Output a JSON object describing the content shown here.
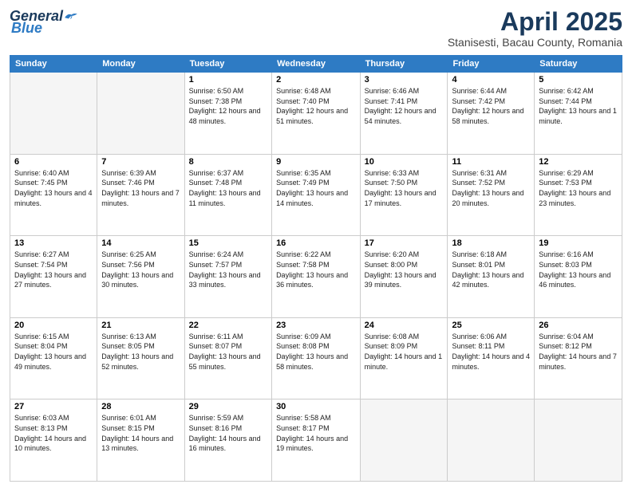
{
  "header": {
    "logo": {
      "general": "General",
      "blue": "Blue"
    },
    "month": "April 2025",
    "location": "Stanisesti, Bacau County, Romania"
  },
  "weekdays": [
    "Sunday",
    "Monday",
    "Tuesday",
    "Wednesday",
    "Thursday",
    "Friday",
    "Saturday"
  ],
  "weeks": [
    [
      {
        "num": "",
        "empty": true
      },
      {
        "num": "",
        "empty": true
      },
      {
        "num": "1",
        "sunrise": "6:50 AM",
        "sunset": "7:38 PM",
        "daylight": "12 hours and 48 minutes."
      },
      {
        "num": "2",
        "sunrise": "6:48 AM",
        "sunset": "7:40 PM",
        "daylight": "12 hours and 51 minutes."
      },
      {
        "num": "3",
        "sunrise": "6:46 AM",
        "sunset": "7:41 PM",
        "daylight": "12 hours and 54 minutes."
      },
      {
        "num": "4",
        "sunrise": "6:44 AM",
        "sunset": "7:42 PM",
        "daylight": "12 hours and 58 minutes."
      },
      {
        "num": "5",
        "sunrise": "6:42 AM",
        "sunset": "7:44 PM",
        "daylight": "13 hours and 1 minute."
      }
    ],
    [
      {
        "num": "6",
        "sunrise": "6:40 AM",
        "sunset": "7:45 PM",
        "daylight": "13 hours and 4 minutes."
      },
      {
        "num": "7",
        "sunrise": "6:39 AM",
        "sunset": "7:46 PM",
        "daylight": "13 hours and 7 minutes."
      },
      {
        "num": "8",
        "sunrise": "6:37 AM",
        "sunset": "7:48 PM",
        "daylight": "13 hours and 11 minutes."
      },
      {
        "num": "9",
        "sunrise": "6:35 AM",
        "sunset": "7:49 PM",
        "daylight": "13 hours and 14 minutes."
      },
      {
        "num": "10",
        "sunrise": "6:33 AM",
        "sunset": "7:50 PM",
        "daylight": "13 hours and 17 minutes."
      },
      {
        "num": "11",
        "sunrise": "6:31 AM",
        "sunset": "7:52 PM",
        "daylight": "13 hours and 20 minutes."
      },
      {
        "num": "12",
        "sunrise": "6:29 AM",
        "sunset": "7:53 PM",
        "daylight": "13 hours and 23 minutes."
      }
    ],
    [
      {
        "num": "13",
        "sunrise": "6:27 AM",
        "sunset": "7:54 PM",
        "daylight": "13 hours and 27 minutes."
      },
      {
        "num": "14",
        "sunrise": "6:25 AM",
        "sunset": "7:56 PM",
        "daylight": "13 hours and 30 minutes."
      },
      {
        "num": "15",
        "sunrise": "6:24 AM",
        "sunset": "7:57 PM",
        "daylight": "13 hours and 33 minutes."
      },
      {
        "num": "16",
        "sunrise": "6:22 AM",
        "sunset": "7:58 PM",
        "daylight": "13 hours and 36 minutes."
      },
      {
        "num": "17",
        "sunrise": "6:20 AM",
        "sunset": "8:00 PM",
        "daylight": "13 hours and 39 minutes."
      },
      {
        "num": "18",
        "sunrise": "6:18 AM",
        "sunset": "8:01 PM",
        "daylight": "13 hours and 42 minutes."
      },
      {
        "num": "19",
        "sunrise": "6:16 AM",
        "sunset": "8:03 PM",
        "daylight": "13 hours and 46 minutes."
      }
    ],
    [
      {
        "num": "20",
        "sunrise": "6:15 AM",
        "sunset": "8:04 PM",
        "daylight": "13 hours and 49 minutes."
      },
      {
        "num": "21",
        "sunrise": "6:13 AM",
        "sunset": "8:05 PM",
        "daylight": "13 hours and 52 minutes."
      },
      {
        "num": "22",
        "sunrise": "6:11 AM",
        "sunset": "8:07 PM",
        "daylight": "13 hours and 55 minutes."
      },
      {
        "num": "23",
        "sunrise": "6:09 AM",
        "sunset": "8:08 PM",
        "daylight": "13 hours and 58 minutes."
      },
      {
        "num": "24",
        "sunrise": "6:08 AM",
        "sunset": "8:09 PM",
        "daylight": "14 hours and 1 minute."
      },
      {
        "num": "25",
        "sunrise": "6:06 AM",
        "sunset": "8:11 PM",
        "daylight": "14 hours and 4 minutes."
      },
      {
        "num": "26",
        "sunrise": "6:04 AM",
        "sunset": "8:12 PM",
        "daylight": "14 hours and 7 minutes."
      }
    ],
    [
      {
        "num": "27",
        "sunrise": "6:03 AM",
        "sunset": "8:13 PM",
        "daylight": "14 hours and 10 minutes."
      },
      {
        "num": "28",
        "sunrise": "6:01 AM",
        "sunset": "8:15 PM",
        "daylight": "14 hours and 13 minutes."
      },
      {
        "num": "29",
        "sunrise": "5:59 AM",
        "sunset": "8:16 PM",
        "daylight": "14 hours and 16 minutes."
      },
      {
        "num": "30",
        "sunrise": "5:58 AM",
        "sunset": "8:17 PM",
        "daylight": "14 hours and 19 minutes."
      },
      {
        "num": "",
        "empty": true
      },
      {
        "num": "",
        "empty": true
      },
      {
        "num": "",
        "empty": true
      }
    ]
  ]
}
